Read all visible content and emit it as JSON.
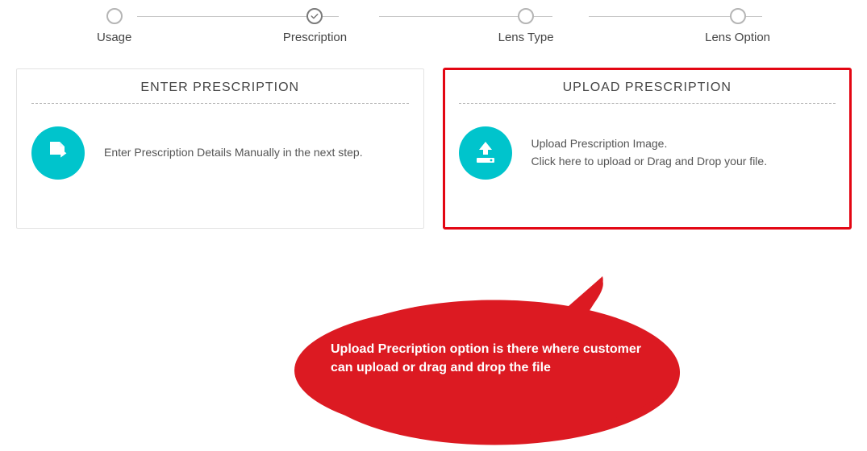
{
  "stepper": {
    "steps": [
      {
        "label": "Usage"
      },
      {
        "label": "Prescription"
      },
      {
        "label": "Lens Type"
      },
      {
        "label": "Lens Option"
      }
    ]
  },
  "cards": {
    "enter": {
      "title": "ENTER PRESCRIPTION",
      "desc": "Enter Prescription Details Manually in the next step."
    },
    "upload": {
      "title": "UPLOAD PRESCRIPTION",
      "line1": "Upload Prescription Image.",
      "line2": "Click here to upload or Drag and Drop your file."
    }
  },
  "callout": {
    "text": "Upload Precription option is there where customer can upload or drag and drop the file"
  },
  "colors": {
    "accent": "#00c4cc",
    "highlight": "#e30613"
  }
}
